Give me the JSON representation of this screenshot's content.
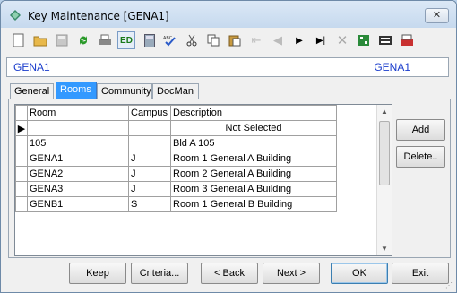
{
  "window": {
    "title": "Key Maintenance  [GENA1]",
    "close_label": "✕"
  },
  "toolbar": {
    "icons": [
      "new-document-icon",
      "open-folder-icon",
      "save-icon",
      "refresh-icon",
      "print-icon",
      "edit-icon",
      "calculator-icon",
      "spell-check-icon",
      "cut-icon",
      "copy-icon",
      "paste-icon",
      "first-record-icon",
      "previous-record-icon",
      "next-record-icon",
      "last-record-icon",
      "delete-icon",
      "grid-icon",
      "barcode-icon",
      "export-icon"
    ],
    "edit_label": "ED"
  },
  "key_bar": {
    "left": "GENA1",
    "right": "GENA1"
  },
  "tabs": [
    {
      "label": "General"
    },
    {
      "label": "Rooms"
    },
    {
      "label": "Community"
    },
    {
      "label": "DocMan"
    }
  ],
  "grid": {
    "headers": {
      "room": "Room",
      "campus": "Campus",
      "description": "Description"
    },
    "rows": [
      {
        "room": "",
        "campus": "",
        "description": "Not Selected",
        "current": true
      },
      {
        "room": "105",
        "campus": "",
        "description": "Bld A 105"
      },
      {
        "room": "GENA1",
        "campus": "J",
        "description": "Room 1 General A Building"
      },
      {
        "room": "GENA2",
        "campus": "J",
        "description": "Room 2 General A Building"
      },
      {
        "room": "GENA3",
        "campus": "J",
        "description": "Room 3 General A Building"
      },
      {
        "room": "GENB1",
        "campus": "S",
        "description": "Room 1 General B Building"
      }
    ]
  },
  "side_buttons": {
    "add": "Add",
    "delete": "Delete.."
  },
  "bottom_buttons": {
    "keep": "Keep",
    "criteria": "Criteria...",
    "back": "< Back",
    "next": "Next >",
    "ok": "OK",
    "exit": "Exit"
  },
  "colors": {
    "key_text": "#1a3ccc",
    "active_tab": "#3399ff"
  }
}
